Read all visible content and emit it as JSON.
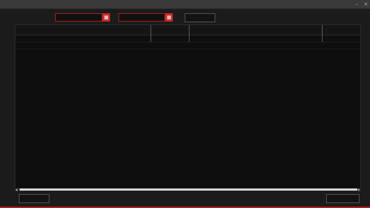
{
  "window": {
    "title": " ",
    "controls": {
      "minimize": "–",
      "close": "×"
    }
  },
  "toolbar": {
    "label": "",
    "date_from": "",
    "date_to": "",
    "query_label": ""
  },
  "table": {
    "columns": [
      "",
      "",
      "",
      "",
      "",
      "",
      "",
      "",
      "",
      "",
      "",
      "",
      "",
      "",
      "",
      "",
      "",
      "",
      ""
    ],
    "rows": [
      [
        "",
        "",
        "",
        "",
        "",
        "",
        "",
        "",
        "",
        "",
        "",
        "",
        "",
        "",
        "",
        "",
        "",
        "",
        ""
      ],
      [
        "",
        "",
        "",
        "",
        "",
        "",
        "",
        "",
        "",
        "",
        "",
        "",
        "",
        "",
        "",
        "",
        "",
        "",
        ""
      ]
    ]
  },
  "footer": {
    "left_button": "",
    "right_button": ""
  },
  "colors": {
    "accent": "#c62828",
    "background": "#1b1b1b"
  },
  "icons": {
    "calendar": "calendar-icon"
  }
}
